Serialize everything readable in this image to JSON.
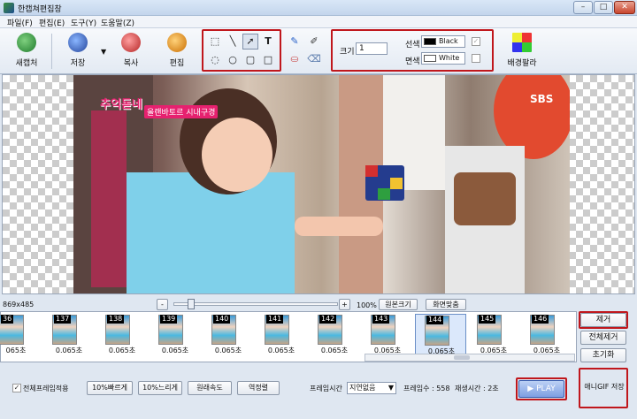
{
  "window": {
    "title": "한캡쳐편집창",
    "minimize": "–",
    "maximize": "□",
    "close": "✕"
  },
  "menu": [
    "파일(F)",
    "편집(E)",
    "도구(Y)",
    "도움말(Z)"
  ],
  "toolbar": {
    "new_capture": "새캡처",
    "save": "저장",
    "copy": "복사",
    "edit": "편집",
    "size_label": "크기",
    "size_value": "1",
    "line_label": "선색",
    "line_color_name": "Black",
    "line_color": "#000000",
    "fill_label": "면색",
    "fill_color_name": "White",
    "fill_color": "#ffffff",
    "bg_palette": "배경팔라"
  },
  "photo": {
    "caption_top": "추억돋네",
    "caption_main": "올랜바토르 시내구경",
    "channel_logo": "SBS"
  },
  "zoom": {
    "dimensions": "869x485",
    "minus": "-",
    "plus": "+",
    "percent": "100%",
    "original_size": "원본크기",
    "fit_screen": "화면맞춤"
  },
  "frames": [
    {
      "num": "36",
      "dur": "065초"
    },
    {
      "num": "137",
      "dur": "0.065초"
    },
    {
      "num": "138",
      "dur": "0.065초"
    },
    {
      "num": "139",
      "dur": "0.065초"
    },
    {
      "num": "140",
      "dur": "0.065초"
    },
    {
      "num": "141",
      "dur": "0.065초"
    },
    {
      "num": "142",
      "dur": "0.065초"
    },
    {
      "num": "143",
      "dur": "0.065초"
    },
    {
      "num": "144",
      "dur": "0.065초"
    },
    {
      "num": "145",
      "dur": "0.065초"
    },
    {
      "num": "146",
      "dur": "0.065초"
    }
  ],
  "right_panel": {
    "remove": "제거",
    "remove_all": "전체제거",
    "reset": "초기화"
  },
  "bottom": {
    "apply_all": "전체프레임적용",
    "faster": "10%빠르게",
    "slower": "10%느리게",
    "original_speed": "원래속도",
    "reverse": "역정렬",
    "frame_time_label": "프레임시간",
    "frame_time_value": "지연없음",
    "frame_count": "프레임수 : 558",
    "play_time": "재생시간 : 2초",
    "play": "PLAY",
    "save_gif": "애니GIF 저장"
  }
}
